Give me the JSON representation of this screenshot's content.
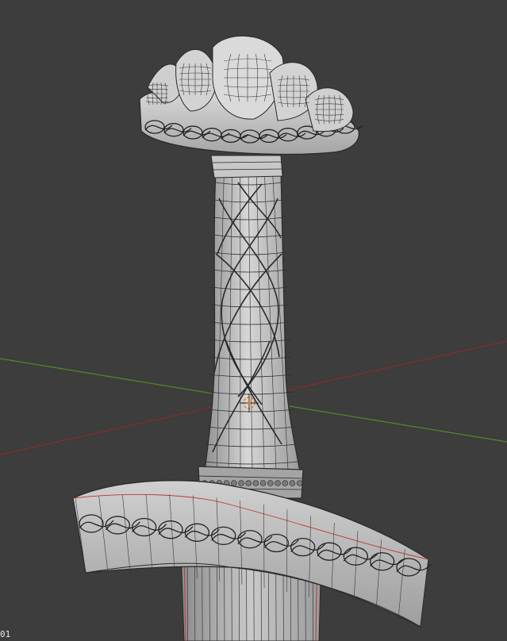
{
  "viewport": {
    "background": "#3d3d3d",
    "axis_x_color": "#8a2b2b",
    "axis_y_color": "#4f8a2b",
    "mesh_fill": "#a9a9a9",
    "mesh_light": "#d4d4d4",
    "wire_color": "#2a2a2a",
    "seam_color": "#c0392b",
    "cursor_color": "#e07a1f",
    "object": "sword-hilt-mesh",
    "frame_text": "01"
  }
}
